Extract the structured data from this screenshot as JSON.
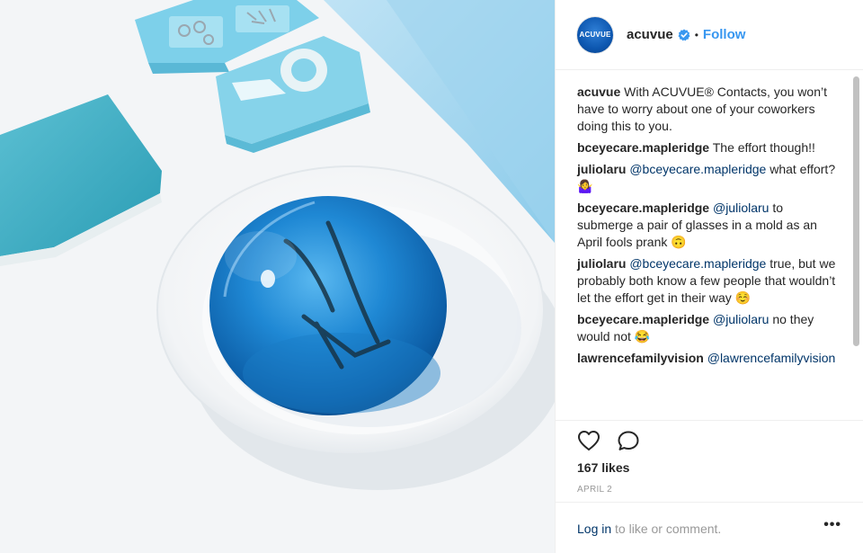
{
  "post": {
    "photo_alt": "glasses submerged in blue jelly dome on a white plate",
    "author": {
      "avatar_text": "ACUVUE",
      "username": "acuvue",
      "verified_icon": "verified-badge-icon",
      "separator": "•",
      "follow_label": "Follow"
    },
    "comments": [
      {
        "user": "acuvue",
        "parts": [
          {
            "t": "With ACUVUE® Contacts, you won’t have to worry about one of your coworkers doing this to you."
          }
        ]
      },
      {
        "user": "bceyecare.mapleridge",
        "parts": [
          {
            "t": "The effort though!!"
          }
        ]
      },
      {
        "user": "juliolaru",
        "parts": [
          {
            "m": "@bceyecare.mapleridge"
          },
          {
            "t": " what effort? 🤷‍♀️"
          }
        ]
      },
      {
        "user": "bceyecare.mapleridge",
        "parts": [
          {
            "m": "@juliolaru"
          },
          {
            "t": " to submerge a pair of glasses in a mold as an April fools prank 🙃"
          }
        ]
      },
      {
        "user": "juliolaru",
        "parts": [
          {
            "m": "@bceyecare.mapleridge"
          },
          {
            "t": " true, but we probably both know a few people that wouldn’t let the effort get in their way ☺️"
          }
        ]
      },
      {
        "user": "bceyecare.mapleridge",
        "parts": [
          {
            "m": "@juliolaru"
          },
          {
            "t": " no they would not 😂"
          }
        ]
      },
      {
        "user": "lawrencefamilyvision",
        "parts": [
          {
            "m": "@lawrencefamilyvision"
          }
        ]
      }
    ],
    "likes_text": "167 likes",
    "date_text": "APRIL 2",
    "login": {
      "link_label": "Log in",
      "rest_text": " to like or comment.",
      "more_label": "•••"
    }
  },
  "icons": {
    "like": "heart-outline-icon",
    "comment": "speech-bubble-icon",
    "more": "more-options-icon"
  },
  "colors": {
    "accent": "#3897f0",
    "mention": "#003569",
    "muted": "#999999",
    "text": "#262626"
  }
}
